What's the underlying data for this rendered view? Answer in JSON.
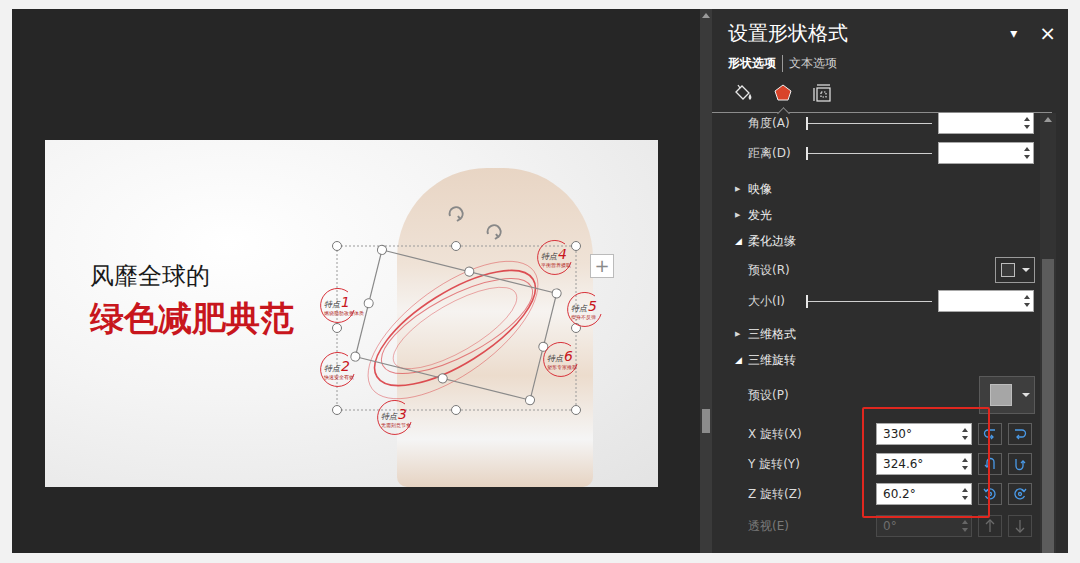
{
  "slide": {
    "title": "风靡全球的",
    "headline": "绿色减肥典范",
    "shape_selected": true,
    "add_button": "+",
    "features": [
      {
        "label": "特点",
        "number": "1",
        "caption": "燃烧脂肪改善体质"
      },
      {
        "label": "特点",
        "number": "2",
        "caption": "快速安全有效"
      },
      {
        "label": "特点",
        "number": "3",
        "caption": "无需刻意节食"
      },
      {
        "label": "特点",
        "number": "4",
        "caption": "平衡营养摄取"
      },
      {
        "label": "特点",
        "number": "5",
        "caption": "瘦身不反弹"
      },
      {
        "label": "特点",
        "number": "6",
        "caption": "塑形专家推荐"
      }
    ]
  },
  "panel": {
    "title": "设置形状格式",
    "menu": "▾",
    "close": "×",
    "tabs": [
      {
        "label": "形状选项",
        "selected": true
      },
      {
        "label": "文本选项",
        "selected": false
      }
    ],
    "icon_tabs": [
      {
        "kind": "fill",
        "selected": false
      },
      {
        "kind": "effects",
        "selected": true
      },
      {
        "kind": "size",
        "selected": false
      }
    ],
    "rows": [
      {
        "kind": "slider",
        "label": "角度(A)",
        "level": 0,
        "value": ""
      },
      {
        "kind": "slider",
        "label": "距离(D)",
        "level": 0,
        "value": ""
      },
      {
        "kind": "group",
        "icon": "▶",
        "label": "映像",
        "expanded": false
      },
      {
        "kind": "group",
        "icon": "▶",
        "label": "发光",
        "expanded": false
      },
      {
        "kind": "group",
        "icon": "◢",
        "label": "柔化边缘",
        "expanded": true
      },
      {
        "kind": "preset",
        "label": "预设(R)"
      },
      {
        "kind": "slider",
        "label": "大小(I)",
        "level": 0,
        "value": ""
      },
      {
        "kind": "group",
        "icon": "▶",
        "label": "三维格式",
        "expanded": false
      },
      {
        "kind": "group",
        "icon": "◢",
        "label": "三维旋转",
        "expanded": true
      },
      {
        "kind": "preset-large",
        "label": "预设(P)"
      },
      {
        "kind": "spin-group",
        "highlighted": true,
        "rows": [
          {
            "label": "X 旋转(X)",
            "value": "330°",
            "disabled": false
          },
          {
            "label": "Y 旋转(Y)",
            "value": "324.6°",
            "disabled": false
          },
          {
            "label": "Z 旋转(Z)",
            "value": "60.2°",
            "disabled": false
          }
        ]
      },
      {
        "kind": "spin",
        "label": "透视(E)",
        "value": "0°",
        "disabled": true
      }
    ]
  }
}
